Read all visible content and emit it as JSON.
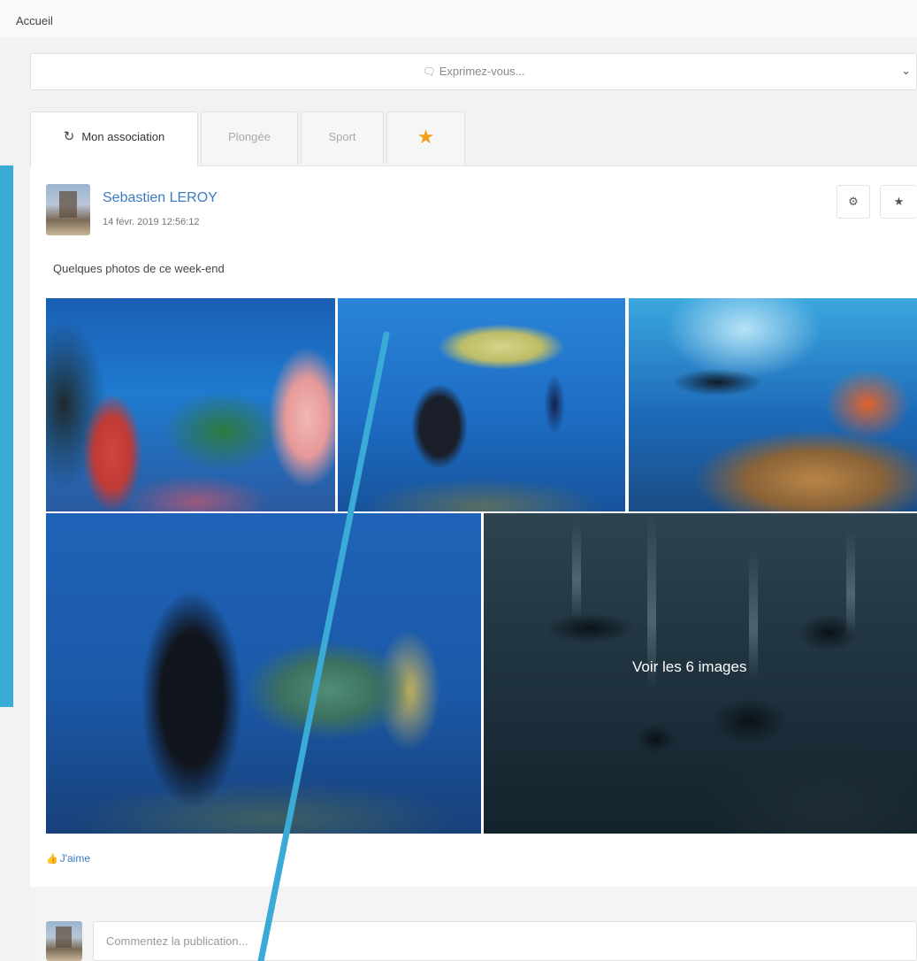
{
  "breadcrumb": "Accueil",
  "composer": {
    "placeholder": "Exprimez-vous...",
    "chat_icon": "chat-bubble-icon",
    "expand_icon": "chevron-down-icon"
  },
  "tabs": [
    {
      "label": "Mon association",
      "icon": "refresh-icon",
      "active": true
    },
    {
      "label": "Plongée",
      "active": false
    },
    {
      "label": "Sport",
      "active": false
    },
    {
      "label": "",
      "icon": "star-icon",
      "active": false
    }
  ],
  "post": {
    "author": "Sebastien LEROY",
    "date": "14 févr. 2019 12:56:12",
    "text": "Quelques photos de ce week-end",
    "actions": [
      "gear-icon",
      "star-icon"
    ],
    "gallery": {
      "photos": [
        "coral-reef-photo",
        "turtle-diver-photo",
        "diver-reef-photo",
        "diver-turtle-photo",
        "divers-group-photo"
      ],
      "more_label": "Voir les 6 images"
    },
    "like_label": "J'aime",
    "comment_placeholder": "Commentez la publication..."
  },
  "colors": {
    "link": "#3b7cc4",
    "star": "#f2a01b",
    "accent_annotation": "#3aaad6"
  }
}
